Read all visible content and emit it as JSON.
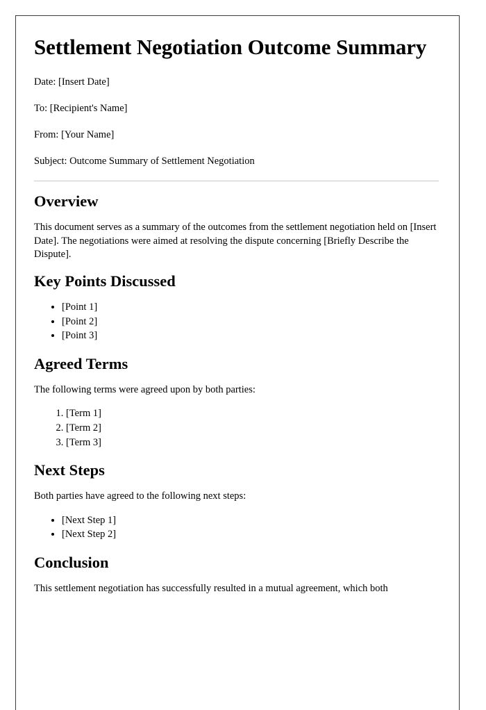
{
  "document": {
    "title": "Settlement Negotiation Outcome Summary",
    "meta": {
      "date": "Date: [Insert Date]",
      "to": "To: [Recipient's Name]",
      "from": "From: [Your Name]",
      "subject": "Subject: Outcome Summary of Settlement Negotiation"
    },
    "sections": {
      "overview": {
        "heading": "Overview",
        "paragraph": "This document serves as a summary of the outcomes from the settlement negotiation held on [Insert Date]. The negotiations were aimed at resolving the dispute concerning [Briefly Describe the Dispute]."
      },
      "key_points": {
        "heading": "Key Points Discussed",
        "items": [
          "[Point 1]",
          "[Point 2]",
          "[Point 3]"
        ]
      },
      "agreed_terms": {
        "heading": "Agreed Terms",
        "intro": "The following terms were agreed upon by both parties:",
        "items": [
          "[Term 1]",
          "[Term 2]",
          "[Term 3]"
        ]
      },
      "next_steps": {
        "heading": "Next Steps",
        "intro": "Both parties have agreed to the following next steps:",
        "items": [
          "[Next Step 1]",
          "[Next Step 2]"
        ]
      },
      "conclusion": {
        "heading": "Conclusion",
        "paragraph": "This settlement negotiation has successfully resulted in a mutual agreement, which both"
      }
    }
  },
  "colors": {
    "page_border": "#3b3b3b",
    "rule": "#c9c9c9",
    "text": "#000000",
    "background": "#ffffff"
  }
}
